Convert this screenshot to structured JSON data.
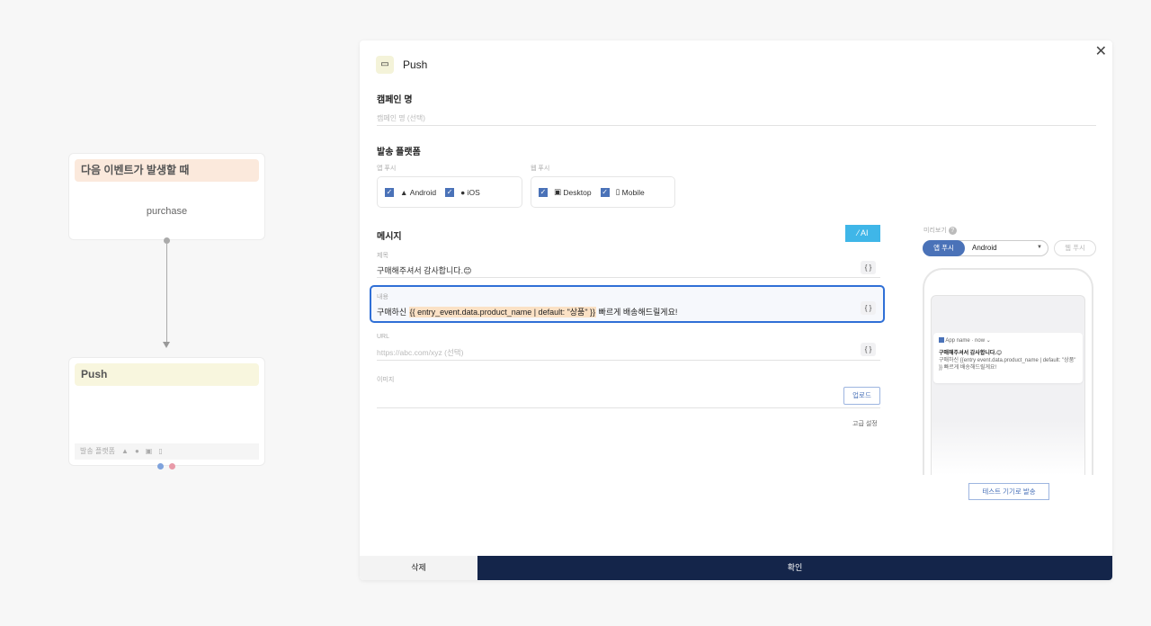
{
  "flow": {
    "trigger": {
      "title": "다음 이벤트가 발생할 때",
      "event": "purchase"
    },
    "push": {
      "title": "Push",
      "footer_label": "발송 플랫폼",
      "icons": [
        "android-icon",
        "apple-icon",
        "desktop-icon",
        "mobile-icon"
      ]
    }
  },
  "modal": {
    "title": "Push",
    "icon": "message-icon",
    "campaign": {
      "label": "캠페인 명",
      "placeholder": "캠페인 명 (선택)"
    },
    "platform": {
      "label": "발송 플랫폼",
      "app": {
        "label": "앱 푸시",
        "items": [
          {
            "label": "Android",
            "checked": true
          },
          {
            "label": "iOS",
            "checked": true
          }
        ]
      },
      "web": {
        "label": "웹 푸시",
        "items": [
          {
            "label": "Desktop",
            "checked": true
          },
          {
            "label": "Mobile",
            "checked": true
          }
        ]
      }
    },
    "message": {
      "label": "메시지",
      "ai_label": "AI",
      "title_label": "제목",
      "title_value": "구매해주셔서 감사합니다.😊",
      "body_label": "내용",
      "body_prefix": "구매하신 ",
      "body_var": "{{ entry_event.data.product_name | default: \"상품\" }}",
      "body_suffix": " 빠르게 배송해드릴게요!",
      "url_label": "URL",
      "url_placeholder": "https://abc.com/xyz (선택)",
      "image_label": "이미지",
      "upload_label": "업로드",
      "advanced_label": "고급 설정",
      "brace": "{ }"
    },
    "preview": {
      "label": "미리보기",
      "tab_app": "앱 푸시",
      "os_select": "Android",
      "tab_web": "웹 푸시",
      "notif_app": "App name · now",
      "notif_title": "구매해주셔서 감사합니다.😊",
      "notif_body": "구매하신 {{entry event.data.product_name | default: \"상품\" }} 빠르게 배송해드릴게요!",
      "test_button": "테스트 기기로 발송"
    },
    "footer": {
      "delete": "삭제",
      "confirm": "확인"
    }
  },
  "colors": {
    "primary": "#4a72b8",
    "navy": "#14254a",
    "ai": "#3fb6e8",
    "focus": "#2f6fd6"
  }
}
